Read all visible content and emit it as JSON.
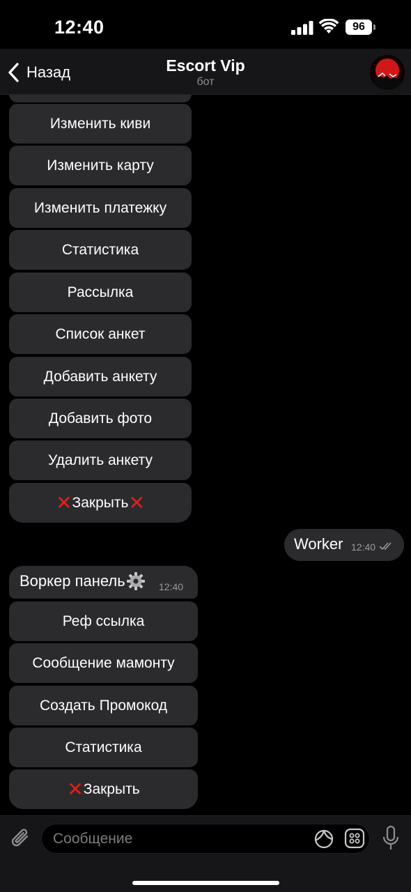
{
  "status_bar": {
    "time": "12:40",
    "battery": "96"
  },
  "header": {
    "back_label": "Назад",
    "title": "Escort Vip",
    "subtitle": "бот"
  },
  "keyboard_admin": [
    "Изменить киви",
    "Изменить карту",
    "Изменить платежку",
    "Статистика",
    "Рассылка",
    "Список анкет",
    "Добавить анкету",
    "Добавить фото",
    "Удалить анкету",
    "Закрыть"
  ],
  "outgoing_message": {
    "text": "Worker",
    "time": "12:40"
  },
  "incoming_message": {
    "text": "Воркер панель",
    "time": "12:40"
  },
  "keyboard_worker": [
    "Реф ссылка",
    "Сообщение мамонту",
    "Создать Промокод",
    "Статистика",
    "Закрыть"
  ],
  "input": {
    "placeholder": "Сообщение"
  },
  "colors": {
    "accent_cross": "#e0201c",
    "bubble": "#2b2b2d",
    "background": "#000000"
  }
}
